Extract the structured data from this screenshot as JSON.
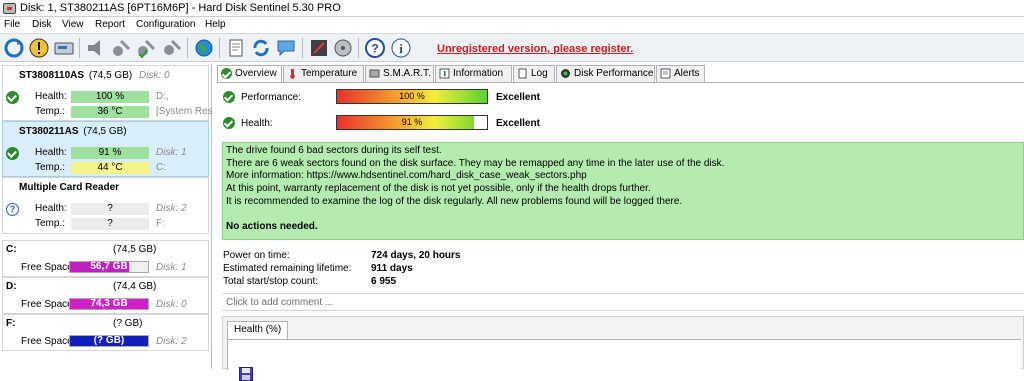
{
  "window": {
    "title": "Disk: 1, ST380211AS [6PT16M6P]  -  Hard Disk Sentinel 5.30 PRO"
  },
  "menu": [
    "File",
    "Disk",
    "View",
    "Report",
    "Configuration",
    "Help"
  ],
  "toolbar": {
    "unregistered_text": "Unregistered version, please register."
  },
  "disks": [
    {
      "name": "ST3808110AS",
      "size": "(74,5 GB)",
      "index": "Disk: 0",
      "health_label": "Health:",
      "health": "100 %",
      "temp_label": "Temp.:",
      "temp": "36 °C",
      "extra1": "D:,",
      "extra2": "[System Rese"
    },
    {
      "name": "ST380211AS",
      "size": "(74,5 GB)",
      "index": "Disk: 1",
      "health_label": "Health:",
      "health": "91 %",
      "temp_label": "Temp.:",
      "temp": "44 °C",
      "extra1": "Disk: 1",
      "extra2": "C:"
    },
    {
      "name": "Multiple Card  Reader",
      "size": "",
      "index": "",
      "health_label": "Health:",
      "health": "?",
      "temp_label": "Temp.:",
      "temp": "?",
      "extra1": "Disk: 2",
      "extra2": "F:"
    }
  ],
  "volumes": [
    {
      "letter": "C:",
      "size": "(74,5 GB)",
      "label": "Free Space",
      "free": "56,7 GB",
      "disk": "Disk: 1",
      "fill_percent": 76,
      "color": "#c020c0"
    },
    {
      "letter": "D:",
      "size": "(74,4 GB)",
      "label": "Free Space",
      "free": "74,3 GB",
      "disk": "Disk: 0",
      "fill_percent": 100,
      "color": "#d020c8"
    },
    {
      "letter": "F:",
      "size": "(? GB)",
      "label": "Free Space",
      "free": "(? GB)",
      "disk": "Disk: 2",
      "fill_percent": 100,
      "color": "#1020b8"
    }
  ],
  "tabs": [
    "Overview",
    "Temperature",
    "S.M.A.R.T.",
    "Information",
    "Log",
    "Disk Performance",
    "Alerts"
  ],
  "overview": {
    "performance_label": "Performance:",
    "performance_value": "100 %",
    "performance_percent": 100,
    "performance_rating": "Excellent",
    "health_label": "Health:",
    "health_value": "91 %",
    "health_percent": 91,
    "health_rating": "Excellent",
    "info_lines": [
      "The drive found 6 bad sectors during its self test.",
      "There are 6 weak sectors found on the disk surface. They may be remapped any time in the later use of the disk.",
      "More information: https://www.hdsentinel.com/hard_disk_case_weak_sectors.php",
      "At this point, warranty replacement of the disk is not yet possible, only if the health drops further.",
      "It is recommended to examine the log of the disk regularly. All new problems found will be logged there."
    ],
    "no_actions": "No actions needed.",
    "stats": [
      {
        "key": "Power on time:",
        "value": "724 days, 20 hours"
      },
      {
        "key": "Estimated remaining lifetime:",
        "value": "911 days"
      },
      {
        "key": "Total start/stop count:",
        "value": "6 955"
      }
    ],
    "comment_placeholder": "Click to add comment ...",
    "chart_tab": "Health (%)"
  }
}
